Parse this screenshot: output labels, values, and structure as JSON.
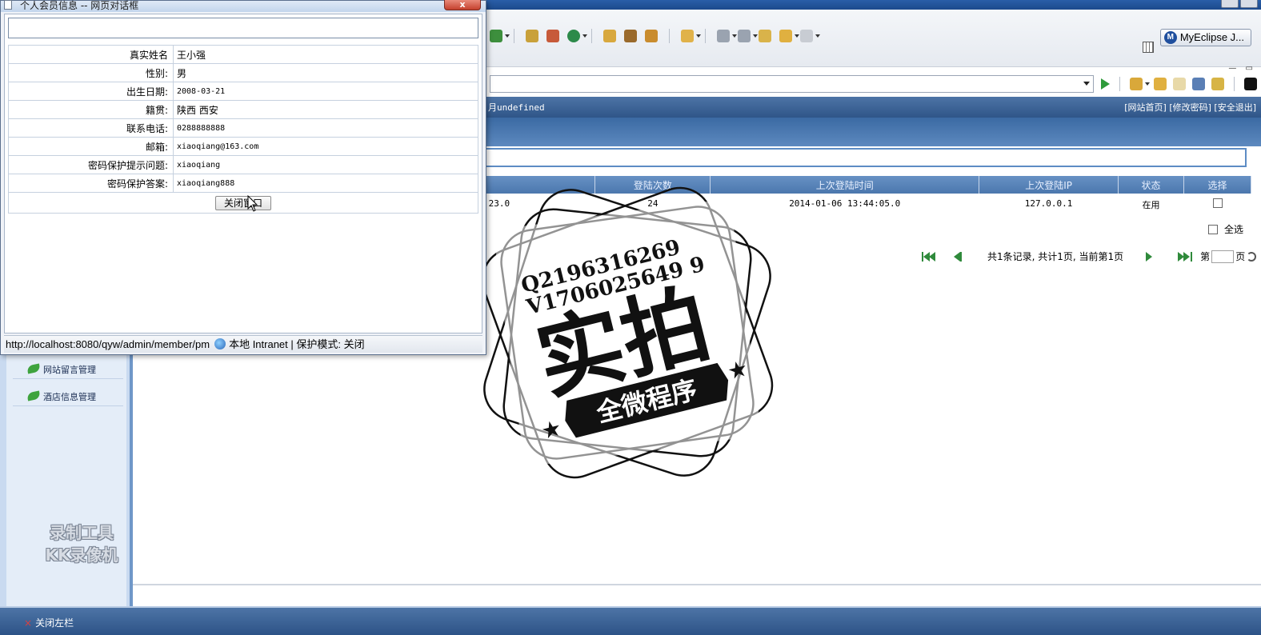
{
  "dialog": {
    "title": "个人会员信息 -- 网页对话框",
    "close_symbol": "x",
    "fields": [
      {
        "label": "真实姓名",
        "value": "王小强"
      },
      {
        "label": "性别:",
        "value": "男"
      },
      {
        "label": "出生日期:",
        "value": "2008-03-21"
      },
      {
        "label": "籍贯:",
        "value": "陕西 西安"
      },
      {
        "label": "联系电话:",
        "value": "0288888888"
      },
      {
        "label": "邮箱:",
        "value": "xiaoqiang@163.com"
      },
      {
        "label": "密码保护提示问题:",
        "value": "xiaoqiang"
      },
      {
        "label": "密码保护答案:",
        "value": "xiaoqiang888"
      }
    ],
    "close_button_label": "关闭窗口",
    "status_url": "http://localhost:8080/qyw/admin/member/pm",
    "status_zone": "本地 Intranet | 保护模式: 关闭"
  },
  "ide": {
    "perspective_label": "MyEclipse J...",
    "perspective_logo": "M"
  },
  "admin": {
    "header_left": "月undefined",
    "header_right": "[网站首页] [修改密码] [安全退出]",
    "table": {
      "headers": [
        "",
        "登陆次数",
        "上次登陆时间",
        "上次登陆IP",
        "状态",
        "选择"
      ],
      "row": {
        "partial_time": ":23.0",
        "login_count": "24",
        "last_login_time": "2014-01-06 13:44:05.0",
        "last_login_ip": "127.0.0.1",
        "status": "在用"
      }
    },
    "select_all_label": "全选",
    "pager": {
      "summary": "共1条记录, 共计1页, 当前第1页",
      "page_prefix": "第",
      "page_suffix": "页"
    },
    "menu": [
      "网站留言管理",
      "酒店信息管理"
    ],
    "footer_close_left": "关闭左栏"
  },
  "watermarks": {
    "recorder_line1": "录制工具",
    "recorder_line2": "KK录像机",
    "stamp_qq": "Q2196316269",
    "stamp_v": "V1706025649 9",
    "stamp_main": "实拍",
    "stamp_banner": "全微程序"
  },
  "colors": {
    "admin_header": "#2f5588",
    "grid_header": "#4b77ad",
    "pager_green": "#2f8a3b",
    "dialog_close": "#c4412d"
  }
}
